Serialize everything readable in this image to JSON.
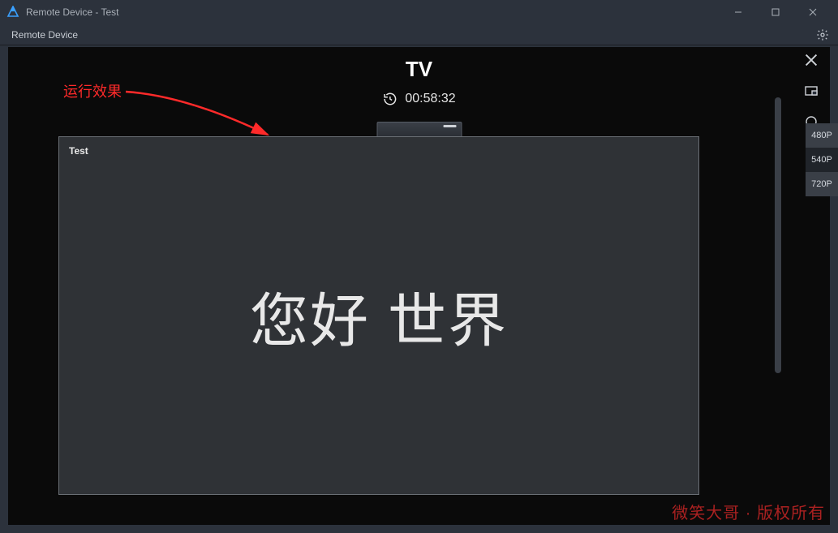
{
  "window": {
    "title": "Remote Device - Test"
  },
  "menu": {
    "remote_label": "Remote Device"
  },
  "annotation": {
    "label": "运行效果"
  },
  "header": {
    "tv_label": "TV",
    "timer": "00:58:32"
  },
  "screen": {
    "app_name": "Test",
    "main_text": "您好 世界"
  },
  "resolution_options": [
    "480P",
    "540P",
    "720P"
  ],
  "resolution_selected": "540P",
  "watermark": "微笑大哥 · 版权所有",
  "colors": {
    "bg": "#2c323c",
    "content_bg": "#0a0a0a",
    "frame_bg": "#2f3236",
    "accent_red": "#ff2a2a"
  },
  "icons": {
    "app": "triangle-logo-icon",
    "minimize": "minimize-icon",
    "maximize": "maximize-icon",
    "close": "close-icon",
    "gear": "gear-icon",
    "history": "history-icon",
    "v_close": "close-icon",
    "v_layout": "layout-toggle-icon",
    "v_circle": "circle-icon",
    "v_back": "back-triangle-icon"
  }
}
